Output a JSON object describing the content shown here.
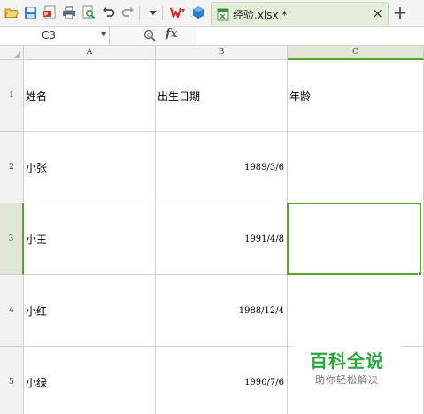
{
  "toolbar": {
    "icons": [
      "open-folder-icon",
      "save-icon",
      "export-pdf-icon",
      "print-icon",
      "print-preview-icon",
      "undo-icon",
      "redo-icon",
      "quick-access-dropdown-icon",
      "wps-logo-icon",
      "cloud-cube-icon"
    ],
    "tab": {
      "title": "经验.xlsx *",
      "close": "×"
    },
    "new_tab": "+"
  },
  "formula_bar": {
    "name_box": "C3",
    "fx": "fx",
    "formula": ""
  },
  "grid": {
    "columns": [
      "A",
      "B",
      "C"
    ],
    "rows": [
      "1",
      "2",
      "3",
      "4",
      "5"
    ],
    "cells": [
      {
        "name": "姓名",
        "birth": "出生日期",
        "age": "年龄"
      },
      {
        "name": "小张",
        "birth": "1989/3/6",
        "age": ""
      },
      {
        "name": "小王",
        "birth": "1991/4/8",
        "age": ""
      },
      {
        "name": "小红",
        "birth": "1988/12/4",
        "age": ""
      },
      {
        "name": "小绿",
        "birth": "1990/7/6",
        "age": ""
      }
    ],
    "selected_cell": "C3",
    "accent_color": "#5ea12b"
  },
  "watermark": {
    "title": "百科全说",
    "subtitle": "助你轻松解决",
    "color": "#2aa53b"
  }
}
